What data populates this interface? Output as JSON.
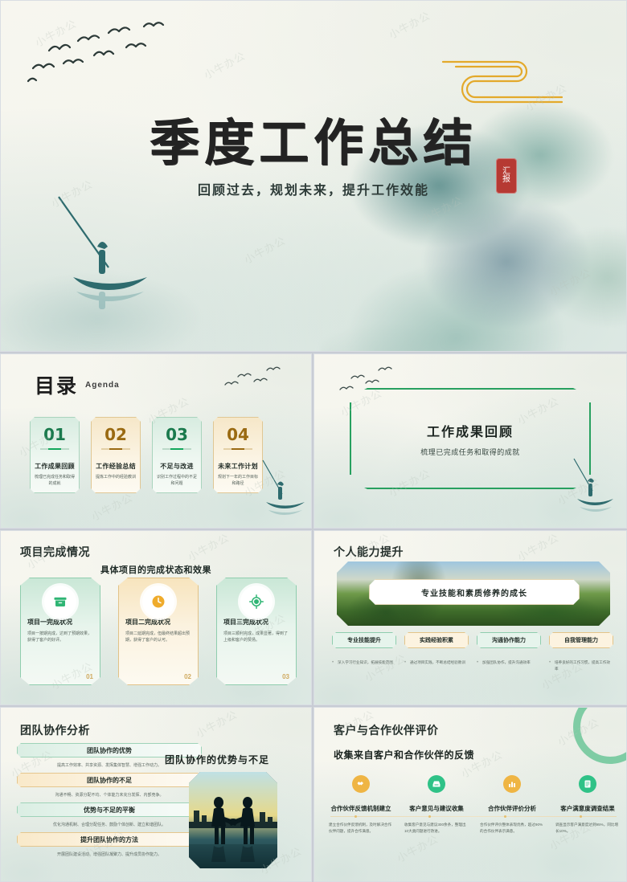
{
  "cover": {
    "title": "季度工作总结",
    "subtitle": "回顾过去，规划未来，提升工作效能",
    "seal_line1": "汇",
    "seal_line2": "报",
    "accent_gold": "#e3a92b",
    "ink_green": "#4e8c7e"
  },
  "agenda": {
    "title": "目录",
    "title_en": "Agenda",
    "items": [
      {
        "num": "01",
        "heading": "工作成果回顾",
        "desc": "梳理已完成任务和取得的成就",
        "tone": "green"
      },
      {
        "num": "02",
        "heading": "工作经验总结",
        "desc": "提炼工作中的经验教训",
        "tone": "gold"
      },
      {
        "num": "03",
        "heading": "不足与改进",
        "desc": "识别工作过程中的不足和问题",
        "tone": "green"
      },
      {
        "num": "04",
        "heading": "未来工作计划",
        "desc": "规划下一年的工作目标和路径",
        "tone": "gold"
      }
    ]
  },
  "section": {
    "heading": "工作成果回顾",
    "desc": "梳理已完成任务和取得的成就",
    "frame_color": "#27a05f"
  },
  "projects": {
    "title": "项目完成情况",
    "subtitle": "具体项目的完成状态和效果",
    "cards": [
      {
        "icon": "archive-box-icon",
        "heading": "项目一完成状况",
        "desc": "项目一按期完成，达到了预期效果，获得了客户的好评。",
        "num": "01",
        "tone": "green"
      },
      {
        "icon": "clock-icon",
        "heading": "项目二完成状况",
        "desc": "项目二延期完成，但最终结果超出预期，获得了客户的认可。",
        "num": "02",
        "tone": "gold"
      },
      {
        "icon": "target-icon",
        "heading": "项目三完成状况",
        "desc": "项目三顺利完成，成果显著，得到了上级和客户的赞扬。",
        "num": "03",
        "tone": "green"
      }
    ]
  },
  "growth": {
    "title": "个人能力提升",
    "banner": "专业技能和素质修养的成长",
    "pills": [
      {
        "label": "专业技能提升",
        "tone": "green",
        "note": "深入学习行业知识，拓展技能范围"
      },
      {
        "label": "实践经验积累",
        "tone": "gold",
        "note": "通过项目实践，不断总结经验教训"
      },
      {
        "label": "沟通协作能力",
        "tone": "green",
        "note": "加强团队协作，提升沟通效率"
      },
      {
        "label": "自我管理能力",
        "tone": "gold",
        "note": "培养良好的工作习惯，提高工作效率"
      }
    ]
  },
  "team": {
    "title": "团队协作分析",
    "right_heading": "团队协作的优势与不足",
    "items": [
      {
        "bar": "团队协作的优势",
        "tone": "green",
        "desc": "提高工作效率、共享资源、发挥集体智慧、增强工作动力。"
      },
      {
        "bar": "团队协作的不足",
        "tone": "gold",
        "desc": "沟通不畅、资源分配不均、个体能力未充分发挥、内部竞争。"
      },
      {
        "bar": "优势与不足的平衡",
        "tone": "green",
        "desc": "优化沟通机制、合理分配任务、鼓励个体创新、建立和谐团队。"
      },
      {
        "bar": "提升团队协作的方法",
        "tone": "gold",
        "desc": "开展团队建设活动、增强团队凝聚力、提升成员协作能力。"
      }
    ]
  },
  "client": {
    "title": "客户与合作伙伴评价",
    "subtitle": "收集来自客户和合作伙伴的反馈",
    "columns": [
      {
        "icon": "handshake-icon",
        "tone": "gold",
        "heading": "合作伙伴反馈机制建立",
        "desc": "建立合作伙伴反馈机制，及时解决合作伙伴问题，提升合作满意。"
      },
      {
        "icon": "inbox-icon",
        "tone": "green",
        "heading": "客户意见与建议收集",
        "desc": "收集客户意见与建议300余条，整理出10大类问题进行改进。"
      },
      {
        "icon": "chart-icon",
        "tone": "gold",
        "heading": "合作伙伴评价分析",
        "desc": "合作伙伴评价整体表现优秀，超过90%的合作伙伴表示满意。"
      },
      {
        "icon": "survey-icon",
        "tone": "green",
        "heading": "客户满意度调查结果",
        "desc": "调查显示客户满意度达到95%，同比增长10%。"
      }
    ]
  },
  "watermark": {
    "text": "小牛办公"
  }
}
